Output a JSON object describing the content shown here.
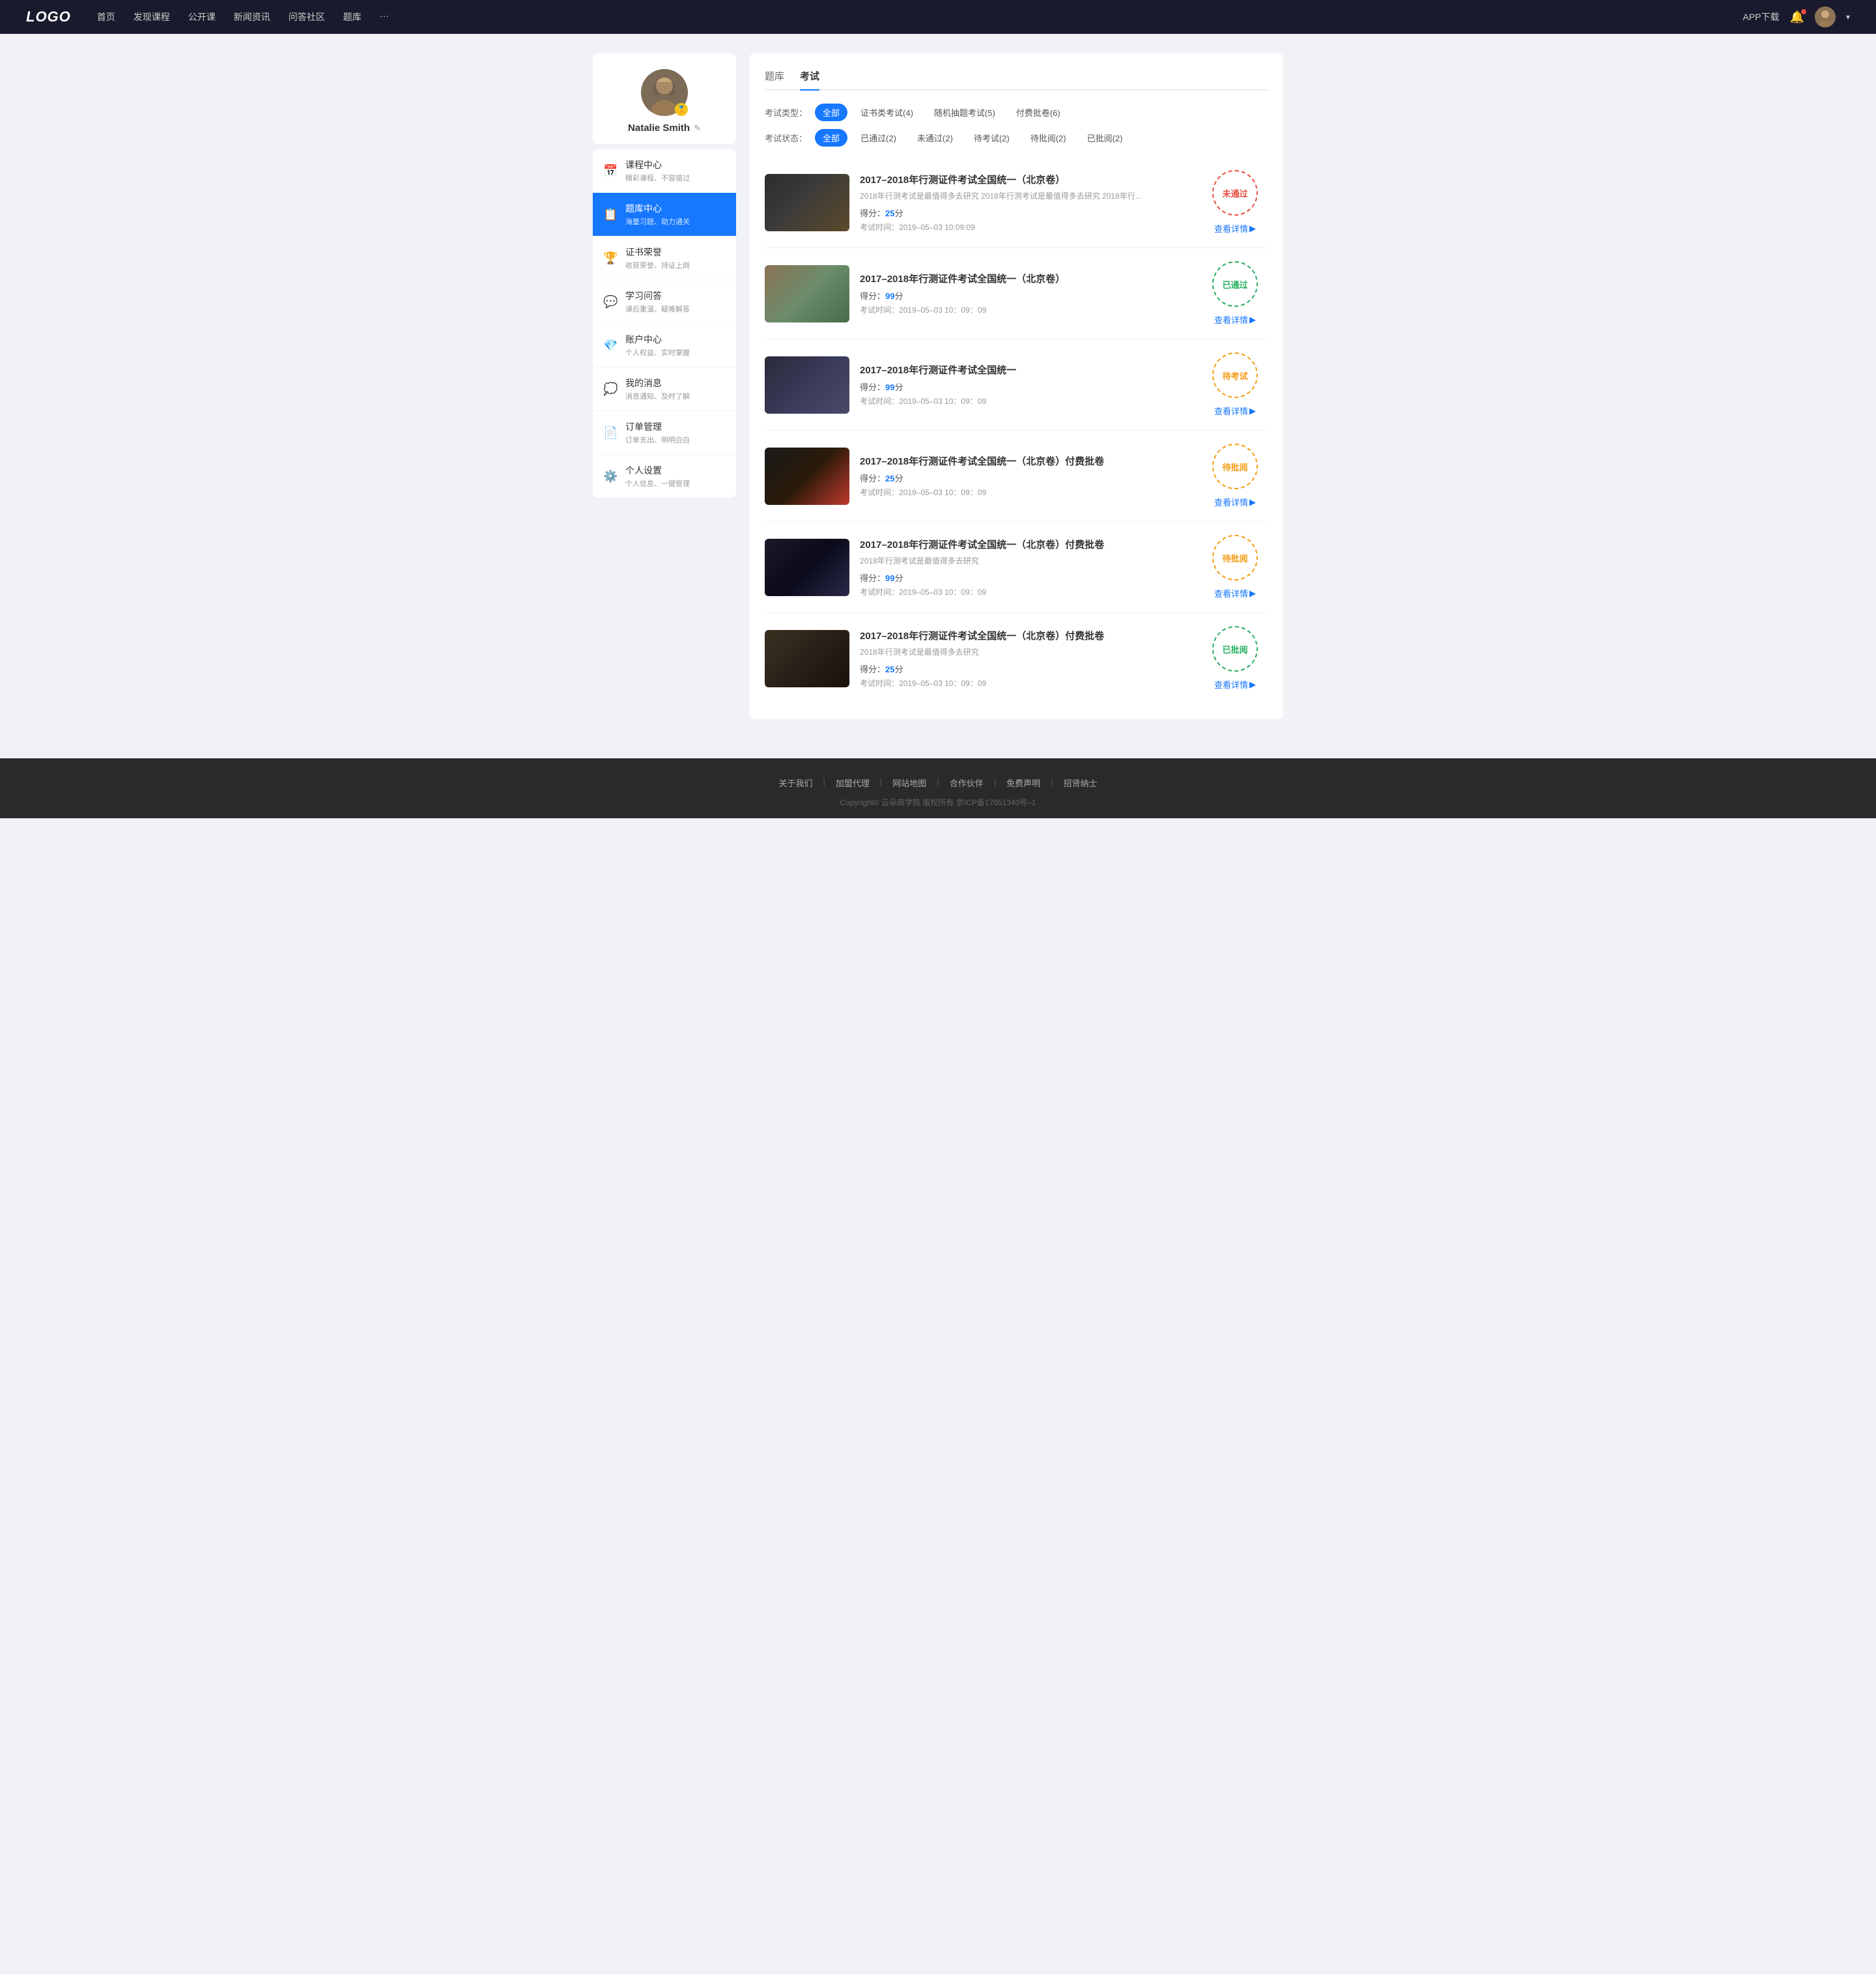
{
  "nav": {
    "logo": "LOGO",
    "links": [
      "首页",
      "发现课程",
      "公开课",
      "新闻资讯",
      "问答社区",
      "题库",
      "···"
    ],
    "app_btn": "APP下载",
    "more_icon": "···"
  },
  "sidebar": {
    "profile": {
      "name": "Natalie Smith",
      "badge": "🏅",
      "edit_icon": "✎"
    },
    "menu": [
      {
        "id": "course",
        "icon": "📅",
        "title": "课程中心",
        "sub": "精彩课程、不容错过",
        "active": false
      },
      {
        "id": "question",
        "icon": "📋",
        "title": "题库中心",
        "sub": "海量习题、助力通关",
        "active": true
      },
      {
        "id": "cert",
        "icon": "🏆",
        "title": "证书荣誉",
        "sub": "收获荣誉、持证上岗",
        "active": false
      },
      {
        "id": "qa",
        "icon": "💬",
        "title": "学习问答",
        "sub": "课后重温、疑难解答",
        "active": false
      },
      {
        "id": "account",
        "icon": "💎",
        "title": "账户中心",
        "sub": "个人权益、实时掌握",
        "active": false
      },
      {
        "id": "message",
        "icon": "💭",
        "title": "我的消息",
        "sub": "消息通知、及时了解",
        "active": false
      },
      {
        "id": "order",
        "icon": "📄",
        "title": "订单管理",
        "sub": "订单支出、明明白白",
        "active": false
      },
      {
        "id": "setting",
        "icon": "⚙️",
        "title": "个人设置",
        "sub": "个人信息、一键管理",
        "active": false
      }
    ]
  },
  "main": {
    "tabs": [
      {
        "id": "question-bank",
        "label": "题库",
        "active": false
      },
      {
        "id": "exam",
        "label": "考试",
        "active": true
      }
    ],
    "filter_type_label": "考试类型：",
    "filter_types": [
      {
        "id": "all",
        "label": "全部",
        "active": true
      },
      {
        "id": "cert",
        "label": "证书类考试(4)",
        "active": false
      },
      {
        "id": "random",
        "label": "随机抽题考试(5)",
        "active": false
      },
      {
        "id": "paid",
        "label": "付费批卷(6)",
        "active": false
      }
    ],
    "filter_status_label": "考试状态：",
    "filter_statuses": [
      {
        "id": "all",
        "label": "全部",
        "active": true
      },
      {
        "id": "passed",
        "label": "已通过(2)",
        "active": false
      },
      {
        "id": "failed",
        "label": "未通过(2)",
        "active": false
      },
      {
        "id": "pending",
        "label": "待考试(2)",
        "active": false
      },
      {
        "id": "pending-review",
        "label": "待批阅(2)",
        "active": false
      },
      {
        "id": "reviewed",
        "label": "已批阅(2)",
        "active": false
      }
    ],
    "exams": [
      {
        "id": 1,
        "thumb_class": "thumb-1",
        "title": "2017–2018年行测证件考试全国统一（北京卷）",
        "desc": "2018年行测考试是最值得多去研究 2018年行测考试是最值得多去研究 2018年行...",
        "score_label": "得分：",
        "score": "25",
        "score_unit": "分",
        "time_label": "考试时间：",
        "time": "2019–05–03  10:09:09",
        "status_text": "未通过",
        "status_class": "stamp-failed",
        "detail_label": "查看详情"
      },
      {
        "id": 2,
        "thumb_class": "thumb-2",
        "title": "2017–2018年行测证件考试全国统一（北京卷）",
        "desc": "",
        "score_label": "得分：",
        "score": "99",
        "score_unit": "分",
        "time_label": "考试时间：",
        "time": "2019–05–03  10：09：09",
        "status_text": "已通过",
        "status_class": "stamp-passed",
        "detail_label": "查看详情"
      },
      {
        "id": 3,
        "thumb_class": "thumb-3",
        "title": "2017–2018年行测证件考试全国统一",
        "desc": "",
        "score_label": "得分：",
        "score": "99",
        "score_unit": "分",
        "time_label": "考试时间：",
        "time": "2019–05–03  10：09：09",
        "status_text": "待考试",
        "status_class": "stamp-pending",
        "detail_label": "查看详情"
      },
      {
        "id": 4,
        "thumb_class": "thumb-4",
        "title": "2017–2018年行测证件考试全国统一（北京卷）付费批卷",
        "desc": "",
        "score_label": "得分：",
        "score": "25",
        "score_unit": "分",
        "time_label": "考试时间：",
        "time": "2019–05–03  10：09：09",
        "status_text": "待批阅",
        "status_class": "stamp-pending",
        "detail_label": "查看详情"
      },
      {
        "id": 5,
        "thumb_class": "thumb-5",
        "title": "2017–2018年行测证件考试全国统一（北京卷）付费批卷",
        "desc": "2018年行测考试是最值得多去研究",
        "score_label": "得分：",
        "score": "99",
        "score_unit": "分",
        "time_label": "考试时间：",
        "time": "2019–05–03  10：09：09",
        "status_text": "待批阅",
        "status_class": "stamp-pending",
        "detail_label": "查看详情"
      },
      {
        "id": 6,
        "thumb_class": "thumb-6",
        "title": "2017–2018年行测证件考试全国统一（北京卷）付费批卷",
        "desc": "2018年行测考试是最值得多去研究",
        "score_label": "得分：",
        "score": "25",
        "score_unit": "分",
        "time_label": "考试时间：",
        "time": "2019–05–03  10：09：09",
        "status_text": "已批阅",
        "status_class": "stamp-review",
        "detail_label": "查看详情"
      }
    ]
  },
  "footer": {
    "links": [
      "关于我们",
      "加盟代理",
      "网站地图",
      "合作伙伴",
      "免费声明",
      "招贤纳士"
    ],
    "copyright": "Copyright©  云朵商学院  版权所有    京ICP备17051340号–1"
  }
}
